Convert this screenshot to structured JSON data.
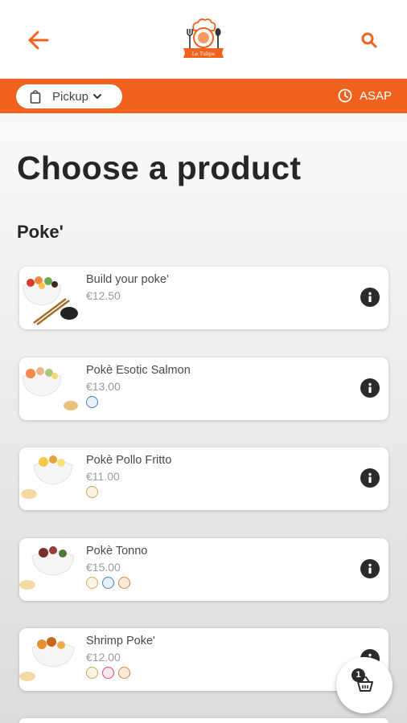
{
  "header": {
    "back_icon": "arrow-left-icon",
    "search_icon": "search-icon",
    "logo_text": "Le Tulipe",
    "accent_color": "#f0621d"
  },
  "order_bar": {
    "mode_label": "Pickup",
    "time_label": "ASAP"
  },
  "page_title": "Choose a product",
  "category": "Poke'",
  "products": [
    {
      "name": "Build your poke'",
      "price": "€12.50"
    },
    {
      "name": "Pokè Esotic Salmon",
      "price": "€13.00"
    },
    {
      "name": "Pokè Pollo Fritto",
      "price": "€11.00"
    },
    {
      "name": "Pokè Tonno",
      "price": "€15.00"
    },
    {
      "name": "Shrimp Poke'",
      "price": "€12.00"
    }
  ],
  "cart": {
    "count": "1"
  }
}
